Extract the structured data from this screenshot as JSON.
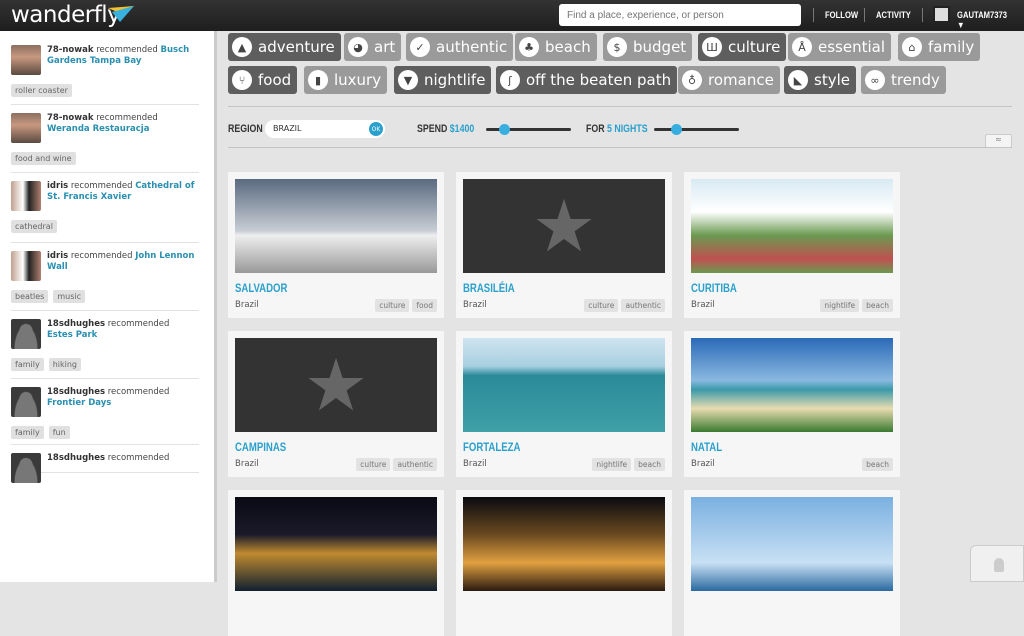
{
  "header": {
    "logo": "wanderfly",
    "search_placeholder": "Find a place, experience, or person",
    "follow": "FOLLOW",
    "activity": "ACTIVITY",
    "username": "GAUTAM7373",
    "caret": "▼"
  },
  "feed": [
    {
      "user": "78-nowak",
      "verb": "recommended",
      "place": "Busch Gardens Tampa Bay",
      "tags": [
        "roller coaster"
      ],
      "avatar": "p"
    },
    {
      "user": "78-nowak",
      "verb": "recommended",
      "place": "Weranda Restauracja",
      "tags": [
        "food and wine"
      ],
      "avatar": "p"
    },
    {
      "user": "idris",
      "verb": "recommended",
      "place": "Cathedral of St. Francis Xavier",
      "tags": [
        "cathedral"
      ],
      "avatar": "w"
    },
    {
      "user": "idris",
      "verb": "recommended",
      "place": "John Lennon Wall",
      "tags": [
        "beatles",
        "music"
      ],
      "avatar": "w"
    },
    {
      "user": "18sdhughes",
      "verb": "recommended",
      "place": "Estes Park",
      "tags": [
        "family",
        "hiking"
      ],
      "avatar": "g"
    },
    {
      "user": "18sdhughes",
      "verb": "recommended",
      "place": "Frontier Days",
      "tags": [
        "family",
        "fun"
      ],
      "avatar": "g"
    },
    {
      "user": "18sdhughes",
      "verb": "recommended",
      "place": "",
      "tags": [],
      "avatar": "g"
    }
  ],
  "categories": [
    {
      "label": "adventure",
      "icon": "mountain-icon",
      "glyph": "▲",
      "active": true
    },
    {
      "label": "art",
      "icon": "palette-icon",
      "glyph": "◕",
      "active": false
    },
    {
      "label": "authentic",
      "icon": "check-icon",
      "glyph": "✓",
      "active": false
    },
    {
      "label": "beach",
      "icon": "palm-icon",
      "glyph": "♣",
      "active": false
    },
    {
      "label": "budget",
      "icon": "dollar-icon",
      "glyph": "$",
      "active": false
    },
    {
      "label": "culture",
      "icon": "columns-icon",
      "glyph": "Ш",
      "active": true
    },
    {
      "label": "essential",
      "icon": "tower-icon",
      "glyph": "Å",
      "active": false
    },
    {
      "label": "family",
      "icon": "house-icon",
      "glyph": "⌂",
      "active": false
    },
    {
      "label": "food",
      "icon": "fork-knife-icon",
      "glyph": "⑂",
      "active": true
    },
    {
      "label": "luxury",
      "icon": "bag-icon",
      "glyph": "▮",
      "active": false
    },
    {
      "label": "nightlife",
      "icon": "cocktail-icon",
      "glyph": "▼",
      "active": true
    },
    {
      "label": "off the beaten path",
      "icon": "path-icon",
      "glyph": "ʃ",
      "active": true
    },
    {
      "label": "romance",
      "icon": "bottle-icon",
      "glyph": "♁",
      "active": false
    },
    {
      "label": "style",
      "icon": "heel-icon",
      "glyph": "◣",
      "active": true
    },
    {
      "label": "trendy",
      "icon": "glasses-icon",
      "glyph": "∞",
      "active": false
    }
  ],
  "filters": {
    "region_label": "REGION",
    "region_value": "BRAZIL",
    "ok": "OK",
    "spend_label": "SPEND",
    "spend_value": "$1400",
    "spend_fraction": 0.15,
    "for_label": "FOR",
    "for_value": "5 NIGHTS",
    "nights_fraction": 0.2
  },
  "cards": [
    {
      "title": "SALVADOR",
      "country": "Brazil",
      "tags": [
        "culture",
        "food"
      ],
      "image": "photo"
    },
    {
      "title": "BRASILÉIA",
      "country": "Brazil",
      "tags": [
        "culture",
        "authentic"
      ],
      "image": "placeholder"
    },
    {
      "title": "CURITIBA",
      "country": "Brazil",
      "tags": [
        "nightlife",
        "beach"
      ],
      "image": "photo"
    },
    {
      "title": "CAMPINAS",
      "country": "Brazil",
      "tags": [
        "culture",
        "authentic"
      ],
      "image": "placeholder"
    },
    {
      "title": "FORTALEZA",
      "country": "Brazil",
      "tags": [
        "nightlife",
        "beach"
      ],
      "image": "photo"
    },
    {
      "title": "NATAL",
      "country": "Brazil",
      "tags": [
        "beach"
      ],
      "image": "photo"
    },
    {
      "title": "",
      "country": "",
      "tags": [],
      "image": "photo"
    },
    {
      "title": "",
      "country": "",
      "tags": [],
      "image": "photo"
    },
    {
      "title": "",
      "country": "",
      "tags": [],
      "image": "photo"
    }
  ]
}
